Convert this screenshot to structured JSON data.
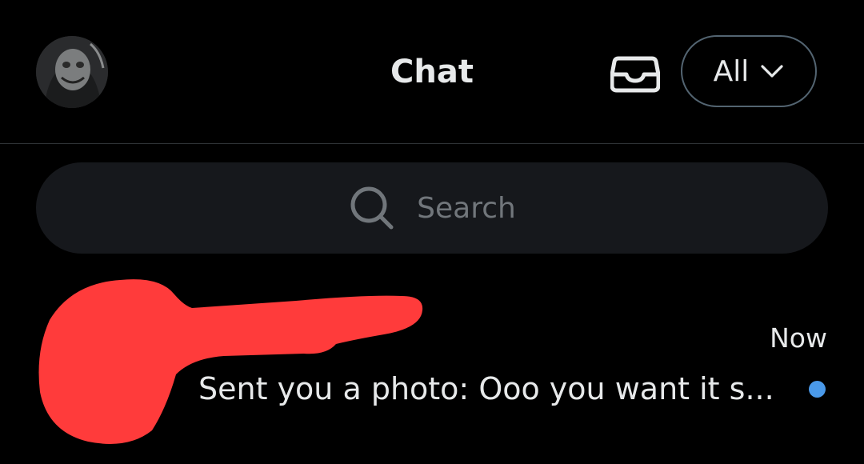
{
  "header": {
    "title": "Chat",
    "filter_label": "All",
    "icons": {
      "inbox": "inbox-tray-icon",
      "chevron": "chevron-down-icon"
    }
  },
  "search": {
    "placeholder": "Search",
    "icon": "search-icon"
  },
  "conversations": [
    {
      "name": "",
      "redacted": true,
      "time": "Now",
      "preview": "Sent you a photo: Ooo you want it s...",
      "unread": true
    }
  ],
  "colors": {
    "background": "#000000",
    "text": "#e7e9ea",
    "muted": "#71767b",
    "search_bg": "#16181c",
    "border": "#2f3336",
    "unread_dot": "#4a99e9",
    "redaction": "#ff3b3b"
  }
}
